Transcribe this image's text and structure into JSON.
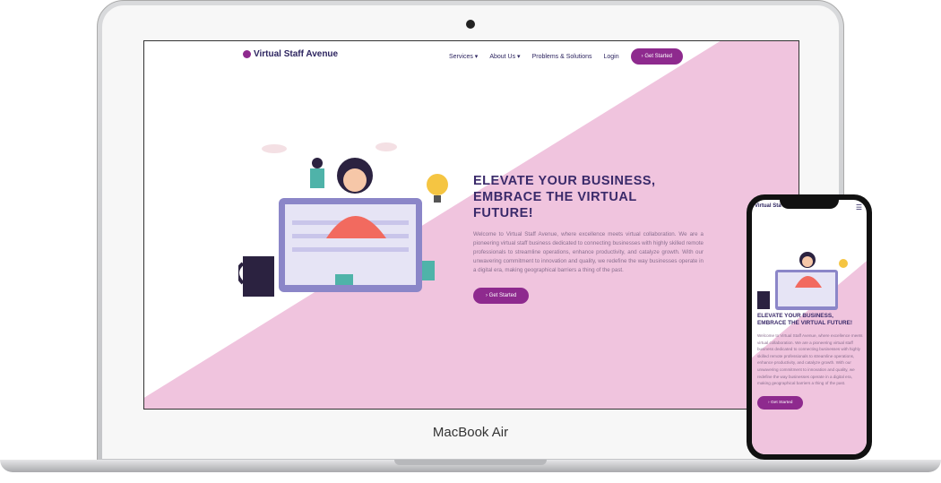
{
  "device": {
    "laptop_label": "MacBook Air"
  },
  "site": {
    "logo": "Virtual Staff Avenue",
    "nav": [
      {
        "label": "Services"
      },
      {
        "label": "About Us"
      },
      {
        "label": "Problems & Solutions"
      },
      {
        "label": "Login"
      }
    ],
    "nav_cta": "Get Started",
    "hero": {
      "heading": "ELEVATE YOUR BUSINESS, EMBRACE THE VIRTUAL FUTURE!",
      "body": "Welcome to Virtual Staff Avenue, where excellence meets virtual collaboration. We are a pioneering virtual staff business dedicated to connecting businesses with highly skilled remote professionals to streamline operations, enhance productivity, and catalyze growth. With our unwavering commitment to innovation and quality, we redefine the way businesses operate in a digital era, making geographical barriers a thing of the past.",
      "cta": "Get Started"
    },
    "mobile_logo": "Virtual Sta"
  },
  "colors": {
    "accent": "#8e2a8e",
    "pink": "#f0c4de",
    "heading": "#3a2a6a"
  }
}
